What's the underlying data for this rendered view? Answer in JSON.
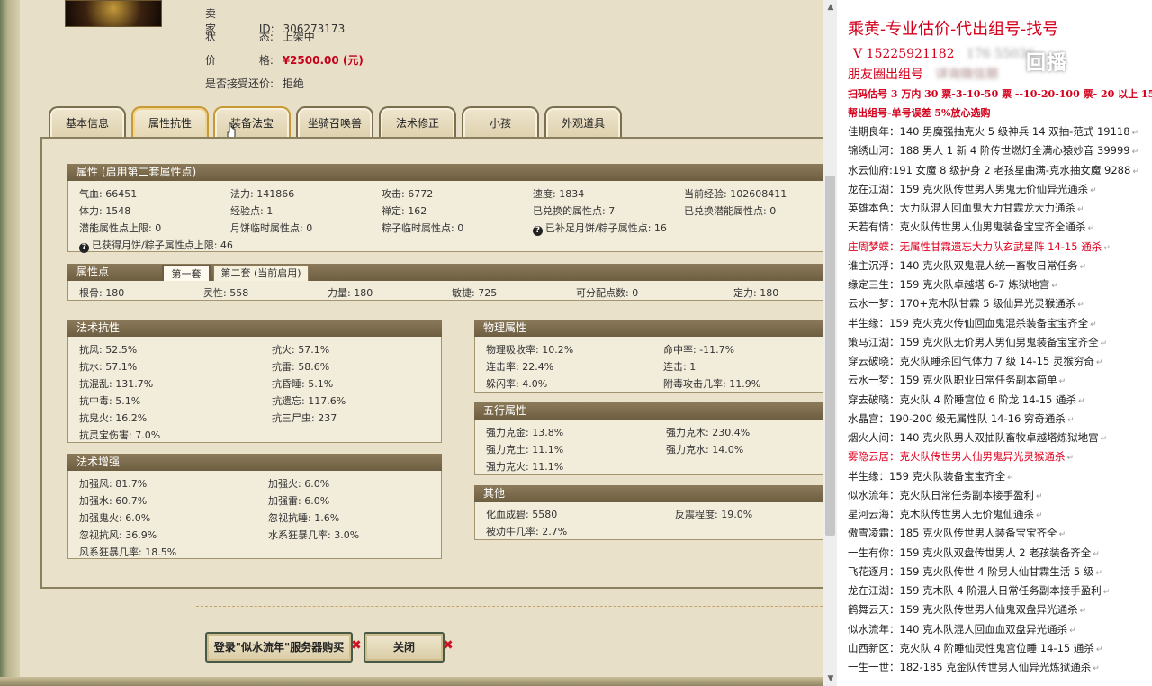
{
  "seller": {
    "id_label": "卖 家",
    "id_key": "ID:",
    "id_value": "306273173",
    "status_label": "状",
    "status_key": "态:",
    "status_value": "上架中",
    "price_label": "价",
    "price_key": "格:",
    "price_value": "¥2500.00 (元)",
    "counter_label": "是否接受还价:",
    "counter_value": "拒绝"
  },
  "tabs": [
    "基本信息",
    "属性抗性",
    "装备法宝",
    "坐骑召唤兽",
    "法术修正",
    "小孩",
    "外观道具"
  ],
  "attributes": {
    "title": "属性 (启用第二套属性点)",
    "row1": [
      "气血: 66451",
      "法力: 141866",
      "攻击: 6772",
      "速度: 1834",
      "当前经验: 102608411"
    ],
    "row2": [
      "体力: 1548",
      "经验点: 1",
      "禅定: 162",
      "已兑换的属性点: 7",
      "已兑换潜能属性点: 0"
    ],
    "row3": [
      "潜能属性点上限: 0",
      "月饼临时属性点: 0",
      "粽子临时属性点: 0",
      "已补足月饼/粽子属性点: 16"
    ],
    "row4": "已获得月饼/粽子属性点上限: 46"
  },
  "attr_points": {
    "title": "属性点",
    "set1": "第一套",
    "set2": "第二套 (当前启用)",
    "values": [
      "根骨: 180",
      "灵性: 558",
      "力量: 180",
      "敏捷: 725",
      "可分配点数: 0",
      "定力: 180"
    ]
  },
  "magic_resist": {
    "title": "法术抗性",
    "left": [
      "抗风: 52.5%",
      "抗水: 57.1%",
      "抗混乱: 131.7%",
      "抗中毒: 5.1%",
      "抗鬼火: 16.2%",
      "抗灵宝伤害: 7.0%"
    ],
    "right": [
      "抗火: 57.1%",
      "抗雷: 58.6%",
      "抗昏睡: 5.1%",
      "抗遗忘: 117.6%",
      "抗三尸虫: 237"
    ]
  },
  "magic_boost": {
    "title": "法术增强",
    "left": [
      "加强风: 81.7%",
      "加强水: 60.7%",
      "加强鬼火: 6.0%",
      "忽视抗风: 36.9%",
      "风系狂暴几率: 18.5%"
    ],
    "right": [
      "加强火: 6.0%",
      "加强雷: 6.0%",
      "忽视抗睡: 1.6%",
      "水系狂暴几率: 3.0%"
    ]
  },
  "physical": {
    "title": "物理属性",
    "left": [
      "物理吸收率: 10.2%",
      "连击率: 22.4%",
      "躲闪率: 4.0%"
    ],
    "right": [
      "命中率: -11.7%",
      "连击: 1",
      "附毒攻击几率: 11.9%"
    ]
  },
  "elements": {
    "title": "五行属性",
    "left": [
      "强力克金: 13.8%",
      "强力克土: 11.1%",
      "强力克火: 11.1%"
    ],
    "right": [
      "强力克木: 230.4%",
      "强力克水: 14.0%"
    ]
  },
  "other": {
    "title": "其他",
    "left": [
      "化血成碧: 5580",
      "被劝牛几率: 2.7%"
    ],
    "right": [
      "反震程度: 19.0%"
    ]
  },
  "buttons": {
    "login": "登录\"似水流年\"服务器购买",
    "close": "关闭"
  },
  "ad": {
    "title": "乘黄-专业估价-代出组号-找号",
    "phone": "V 15225921182",
    "phone_blur": "176 55036",
    "circle": "朋友圈出组号",
    "circle_blur": "详询微信朋",
    "watermark": "回播",
    "promo1": "扫码估号 3 万内 30 票-3-10-50 票 --10-20-100 票- 20 以上 150",
    "promo2": "帮出组号-单号误差 5%放心选购",
    "items": [
      {
        "text": "佳期良年：140 男魔强抽克火 5 级神兵 14 双抽-范式 19118",
        "red": false
      },
      {
        "text": "锦绣山河：188 男人 1 新 4 阶传世燃灯全满心猿妙音 39999",
        "red": false
      },
      {
        "text": "水云仙府:191 女魔 8 级护身 2 老孩星曲满-克水抽女魔 9288",
        "red": false
      },
      {
        "text": "龙在江湖：159 克火队传世男人男鬼无价仙异光通杀",
        "red": false
      },
      {
        "text": "英雄本色：大力队混人回血鬼大力甘霖龙大力通杀",
        "red": false
      },
      {
        "text": "天若有情：克火队传世男人仙男鬼装备宝宝齐全通杀",
        "red": false
      },
      {
        "text": "庄周梦蝶：无属性甘霖遗忘大力队玄武星阵 14-15 通杀",
        "red": true
      },
      {
        "text": "谁主沉浮：140 克火队双鬼混人统一畜牧日常任务",
        "red": false
      },
      {
        "text": "缘定三生：159 克火队卓越塔 6-7 炼狱地宫",
        "red": false
      },
      {
        "text": "云水一梦：170+克木队甘霖 5 级仙异光灵猴通杀",
        "red": false
      },
      {
        "text": "半生缘：159 克火克火传仙回血鬼混杀装备宝宝齐全",
        "red": false
      },
      {
        "text": "策马江湖：159 克火队无价男人男仙男鬼装备宝宝齐全",
        "red": false
      },
      {
        "text": "穿云破晓：克火队睡杀回气体力 7 级 14-15 灵猴穷奇",
        "red": false
      },
      {
        "text": "云水一梦：159 克火队职业日常任务副本简单",
        "red": false
      },
      {
        "text": "穿去破晓：克火队 4 阶睡宫位 6 阶龙 14-15 通杀",
        "red": false
      },
      {
        "text": "水晶宫：190-200 级无属性队 14-16 穷奇通杀",
        "red": false
      },
      {
        "text": "烟火人间：140 克火队男人双抽队畜牧卓越塔炼狱地宫",
        "red": false
      },
      {
        "text": "雾隐云居：克火队传世男人仙男鬼异光灵猴通杀",
        "red": true
      },
      {
        "text": "半生缘：159 克火队装备宝宝齐全",
        "red": false
      },
      {
        "text": "似水流年：克火队日常任务副本接手盈利",
        "red": false
      },
      {
        "text": "星河云海：克木队传世男人无价鬼仙通杀",
        "red": false
      },
      {
        "text": "傲雪凌霜：185 克火队传世男人装备宝宝齐全",
        "red": false
      },
      {
        "text": "一生有你：159 克火队双盘传世男人 2 老孩装备齐全",
        "red": false
      },
      {
        "text": "飞花逐月：159 克火队传世 4 阶男人仙甘霖生活 5 级",
        "red": false
      },
      {
        "text": "龙在江湖：159 克木队 4 阶混人日常任务副本接手盈利",
        "red": false
      },
      {
        "text": "鹤舞云天：159 克火队传世男人仙鬼双盘异光通杀",
        "red": false
      },
      {
        "text": "似水流年：140 克木队混人回血血双盘异光通杀",
        "red": false
      },
      {
        "text": "山西新区：克火队 4 阶睡仙灵性鬼宫位睡 14-15 通杀",
        "red": false
      },
      {
        "text": "一生一世：182-185 克金队传世男人仙异光炼狱通杀",
        "red": false
      }
    ]
  }
}
